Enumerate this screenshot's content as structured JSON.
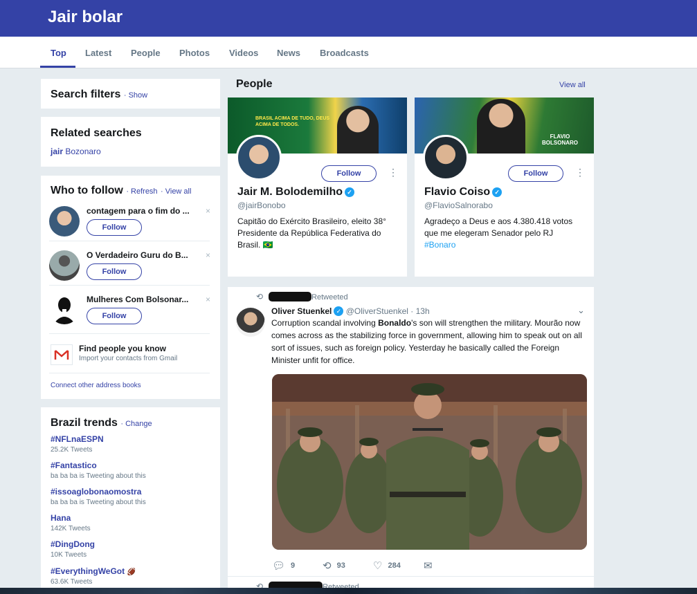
{
  "header": {
    "title": "Jair bolar"
  },
  "tabs": [
    {
      "label": "Top",
      "active": true
    },
    {
      "label": "Latest"
    },
    {
      "label": "People"
    },
    {
      "label": "Photos"
    },
    {
      "label": "Videos"
    },
    {
      "label": "News"
    },
    {
      "label": "Broadcasts"
    }
  ],
  "search_filters": {
    "title": "Search filters",
    "show": "· Show"
  },
  "related": {
    "title": "Related searches",
    "term_bold": "jair",
    "term_rest": " Bozonaro"
  },
  "who_to_follow": {
    "title": "Who to follow",
    "refresh": "· Refresh",
    "view_all": "· View all",
    "follow_label": "Follow",
    "users": [
      {
        "name": "contagem para o fim do ..."
      },
      {
        "name": "O Verdadeiro Guru do B..."
      },
      {
        "name": "Mulheres Com Bolsonar..."
      }
    ],
    "find_people": {
      "title": "Find people you know",
      "subtitle": "Import your contacts from Gmail"
    },
    "connect": "Connect other address books",
    "dismiss": "×"
  },
  "trends": {
    "title": "Brazil trends",
    "change": "· Change",
    "items": [
      {
        "name": "#NFLnaESPN",
        "meta": "25.2K Tweets"
      },
      {
        "name": "#Fantastico",
        "meta": "ba ba ba is Tweeting about this"
      },
      {
        "name": "#issoaglobonaomostra",
        "meta": "ba ba ba is Tweeting about this"
      },
      {
        "name": "Hana",
        "meta": "142K Tweets"
      },
      {
        "name": "#DingDong",
        "meta": "10K Tweets"
      },
      {
        "name": "#EverythingWeGot",
        "meta": "63.6K Tweets"
      }
    ]
  },
  "people": {
    "title": "People",
    "view_all": "View all",
    "follow_label": "Follow",
    "cards": [
      {
        "name": "Jair M. Bolodemilho",
        "handle": "@jairBonobo",
        "bio": "Capitão do Exército Brasileiro, eleito 38° Presidente da República Federativa do Brasil. 🇧🇷",
        "banner_text": "BRASIL ACIMA DE TUDO, DEUS ACIMA DE TODOS."
      },
      {
        "name": "Flavio Coiso",
        "handle": "@FlavioSalnorabo",
        "bio": "Agradeço a Deus e aos 4.380.418 votos que me elegeram Senador pelo RJ",
        "bio_tag": "#Bonaro",
        "banner_text": "FLAVIO BOLSONARO"
      }
    ]
  },
  "tweet": {
    "retweeted_label": "Retweeted",
    "author": "Oliver Stuenkel",
    "handle": "@OliverStuenkel",
    "time": "· 13h",
    "text_before": "Corruption scandal involving ",
    "text_bold": "Bonaldo",
    "text_after": "'s son will strengthen the military. Mourão now comes across as the stabilizing force in government, allowing him to speak out on all sort of issues, such as foreign policy. Yesterday he basically called the Foreign Minister unfit for office.",
    "replies": "9",
    "retweets": "93",
    "likes": "284",
    "next_retweeted_label": "Retweeted"
  }
}
